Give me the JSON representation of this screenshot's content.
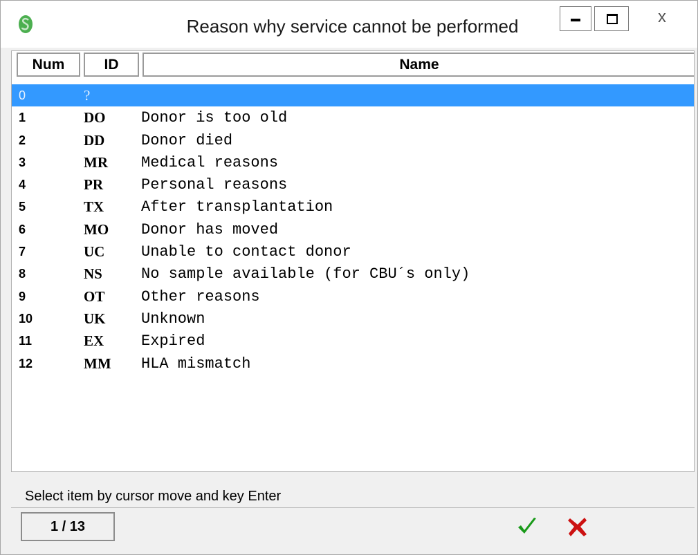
{
  "window": {
    "title": "Reason why service cannot be performed",
    "close_glyph": "x"
  },
  "columns": {
    "num": "Num",
    "id": "ID",
    "name": "Name"
  },
  "rows": [
    {
      "num": "0",
      "id": "?",
      "name": ""
    },
    {
      "num": "1",
      "id": "DO",
      "name": "Donor is too old"
    },
    {
      "num": "2",
      "id": "DD",
      "name": "Donor died"
    },
    {
      "num": "3",
      "id": "MR",
      "name": "Medical reasons"
    },
    {
      "num": "4",
      "id": "PR",
      "name": "Personal reasons"
    },
    {
      "num": "5",
      "id": "TX",
      "name": "After transplantation"
    },
    {
      "num": "6",
      "id": "MO",
      "name": "Donor has moved"
    },
    {
      "num": "7",
      "id": "UC",
      "name": "Unable to contact donor"
    },
    {
      "num": "8",
      "id": "NS",
      "name": "No sample available (for CBU´s only)"
    },
    {
      "num": "9",
      "id": "OT",
      "name": "Other reasons"
    },
    {
      "num": "10",
      "id": "UK",
      "name": "Unknown"
    },
    {
      "num": "11",
      "id": "EX",
      "name": "Expired"
    },
    {
      "num": "12",
      "id": "MM",
      "name": "HLA mismatch"
    }
  ],
  "selected_row": 0,
  "status": {
    "hint": "Select item by cursor move and key Enter",
    "counter": "1 / 13"
  },
  "icons": {
    "app": "app-logo-icon",
    "ok": "checkmark-icon",
    "cancel": "cross-icon"
  },
  "colors": {
    "selection": "#3399ff",
    "ok": "#1a9a1a",
    "cancel": "#cc1111"
  }
}
